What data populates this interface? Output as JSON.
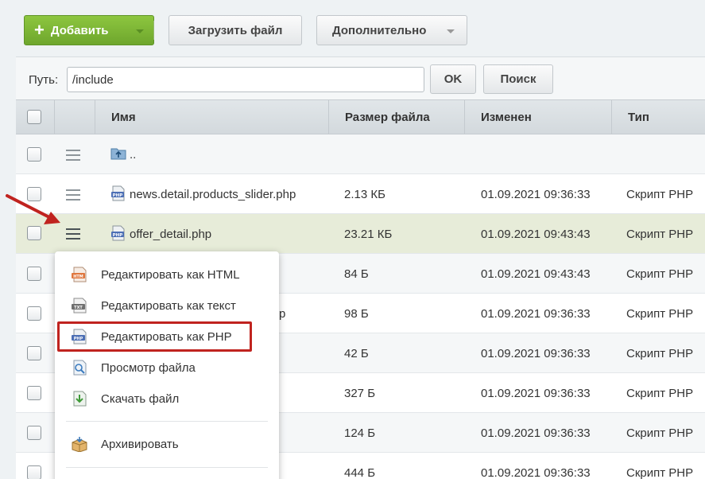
{
  "toolbar": {
    "add_label": "Добавить",
    "upload_label": "Загрузить файл",
    "more_label": "Дополнительно"
  },
  "path": {
    "label": "Путь:",
    "value": "/include",
    "ok_label": "OK",
    "search_label": "Поиск"
  },
  "table": {
    "columns": [
      "Имя",
      "Размер файла",
      "Изменен",
      "Тип"
    ],
    "rows": [
      {
        "name": "..",
        "size": "",
        "modified": "",
        "type": "",
        "icon": "folder-up-icon"
      },
      {
        "name": "news.detail.products_slider.php",
        "size": "2.13 КБ",
        "modified": "01.09.2021 09:36:33",
        "type": "Скрипт PHP",
        "icon": "php-file-icon"
      },
      {
        "name": "offer_detail.php",
        "size": "23.21 КБ",
        "modified": "01.09.2021 09:43:43",
        "type": "Скрипт PHP",
        "icon": "php-file-icon"
      },
      {
        "name": "",
        "size": "84 Б",
        "modified": "01.09.2021 09:43:43",
        "type": "Скрипт PHP"
      },
      {
        "name": "р",
        "size": "98 Б",
        "modified": "01.09.2021 09:36:33",
        "type": "Скрипт PHP"
      },
      {
        "name": "",
        "size": "42 Б",
        "modified": "01.09.2021 09:36:33",
        "type": "Скрипт PHP"
      },
      {
        "name": "",
        "size": "327 Б",
        "modified": "01.09.2021 09:36:33",
        "type": "Скрипт PHP"
      },
      {
        "name": "",
        "size": "124 Б",
        "modified": "01.09.2021 09:36:33",
        "type": "Скрипт PHP"
      },
      {
        "name": "",
        "size": "444 Б",
        "modified": "01.09.2021 09:36:33",
        "type": "Скрипт PHP"
      }
    ]
  },
  "context_menu": {
    "items": [
      {
        "label": "Редактировать как HTML",
        "icon": "html-file-icon"
      },
      {
        "label": "Редактировать как текст",
        "icon": "txt-file-icon"
      },
      {
        "label": "Редактировать как PHP",
        "icon": "php-file-icon"
      },
      {
        "label": "Просмотр файла",
        "icon": "preview-file-icon"
      },
      {
        "label": "Скачать файл",
        "icon": "download-file-icon"
      },
      {
        "label": "Архивировать",
        "icon": "archive-box-icon"
      }
    ]
  },
  "colors": {
    "accent_green": "#7cb734",
    "highlight_row": "#e7ecd9",
    "annotation_red": "#c0231f"
  }
}
